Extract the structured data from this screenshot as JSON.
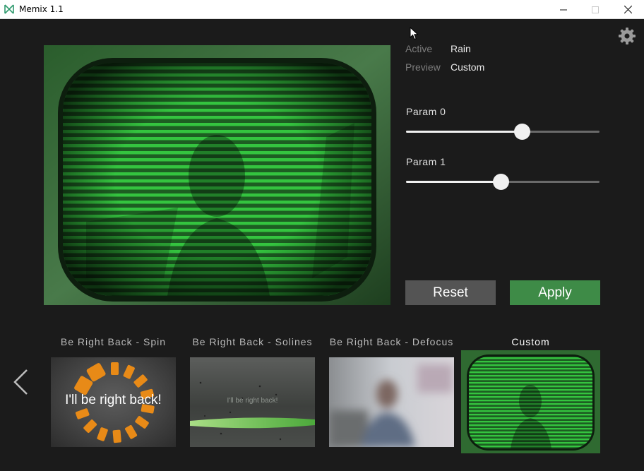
{
  "window": {
    "title": "Memix 1.1",
    "icons": {
      "logo": "memix-logo-icon",
      "minimize": "minimize-icon",
      "maximize": "maximize-icon",
      "close": "close-icon"
    }
  },
  "settings": {
    "icon": "gear-icon"
  },
  "info": {
    "active_label": "Active",
    "active_value": "Rain",
    "preview_label": "Preview",
    "preview_value": "Custom"
  },
  "params": [
    {
      "label": "Param  0",
      "value": 0.6
    },
    {
      "label": "Param  1",
      "value": 0.49
    }
  ],
  "buttons": {
    "reset": "Reset",
    "apply": "Apply"
  },
  "gallery": {
    "prev_icon": "chevron-left-icon",
    "items": [
      {
        "title": "Be  Right  Back  -  Spin",
        "caption": "I'll be right back!"
      },
      {
        "title": "Be  Right  Back  -  Solines",
        "caption": "I'll be right back!"
      },
      {
        "title": "Be  Right  Back  -  Defocus",
        "caption": ""
      },
      {
        "title": "Custom",
        "caption": ""
      }
    ],
    "selected_index": 3
  },
  "colors": {
    "background": "#1b1b1b",
    "accent_green": "#3e8b47",
    "crt_green": "#2fbf3a",
    "reset_gray": "#545454",
    "spin_orange": "#e88a17"
  }
}
